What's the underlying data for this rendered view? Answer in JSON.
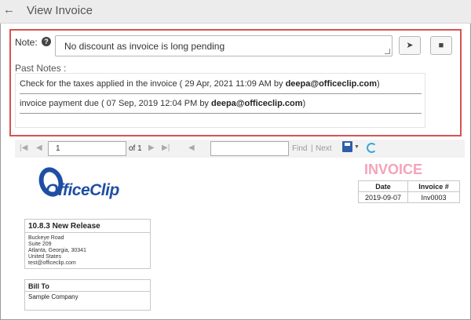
{
  "header": {
    "back_icon": "arrow-left-icon",
    "title": "View Invoice"
  },
  "note_form": {
    "label": "Note:",
    "help_icon_glyph": "?",
    "input_value": "No discount as invoice is long pending",
    "send_icon": "send-icon",
    "clear_icon": "eraser-icon"
  },
  "past_notes": {
    "label": "Past Notes :",
    "items": [
      {
        "text": "Check for the taxes applied in the invoice ( 29 Apr, 2021 11:09 AM by ",
        "author": "deepa@officeclip.com",
        "suffix": ")"
      },
      {
        "text": "invoice payment due ( 07 Sep, 2019 12:04 PM by ",
        "author": "deepa@officeclip.com",
        "suffix": ")"
      }
    ]
  },
  "report_toolbar": {
    "page_number": "1",
    "page_of": "of 1",
    "find_label": "Find",
    "separator": "|",
    "next_label": "Next"
  },
  "invoice": {
    "logo_text": "OfficeClip",
    "title": "INVOICE",
    "date_header": "Date",
    "number_header": "Invoice #",
    "date": "2019-09-07",
    "number": "Inv0003",
    "title_color": "#f4a3b8",
    "company": {
      "name": "10.8.3 New Release",
      "address": [
        "Buckeye Road",
        "Suite 209",
        "Atlanta, Georgia, 30341",
        "United States",
        "test@officeclip.com"
      ]
    },
    "bill_to": {
      "label": "Bill To",
      "name": "Sample Company"
    }
  },
  "colors": {
    "highlight_border": "#d9534f",
    "brand_blue": "#1f4fa3"
  }
}
